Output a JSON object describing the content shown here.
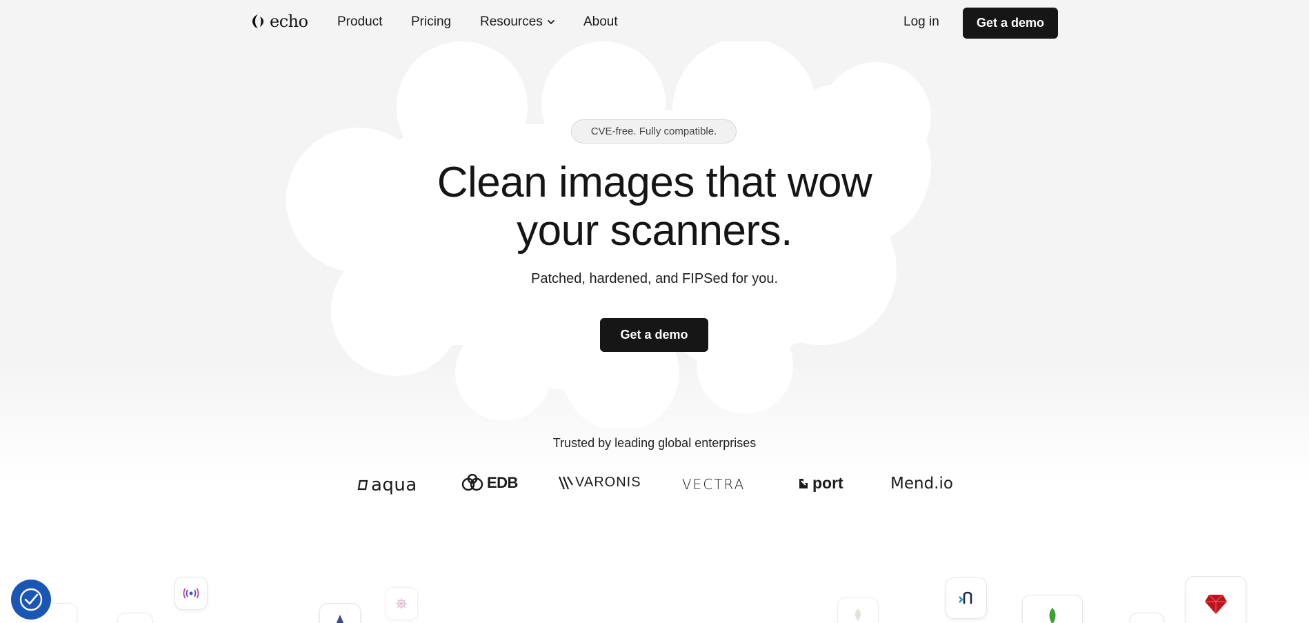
{
  "nav": {
    "logo_text": "echo",
    "links": {
      "product": "Product",
      "pricing": "Pricing",
      "resources": "Resources",
      "about": "About"
    },
    "login": "Log in",
    "cta": "Get a demo"
  },
  "hero": {
    "badge": "CVE-free. Fully compatible.",
    "title_line1": "Clean images that wow",
    "title_line2": "your scanners.",
    "subtitle": "Patched, hardened, and FIPSed for you.",
    "cta": "Get a demo"
  },
  "trust": {
    "heading": "Trusted by leading global enterprises",
    "logos": [
      "aqua",
      "EDB",
      "VARONIS",
      "VECTRA",
      "port",
      "Mend.io"
    ]
  },
  "icons": [
    "accessibility-icon",
    "radio-signal-icon",
    "rocky-linux-icon",
    "helm-icon",
    "nginx-icon",
    "mongodb-leaf-icon",
    "ruby-icon"
  ],
  "colors": {
    "primary_dark": "#161616",
    "accessibility": "#1a56b3",
    "ruby": "#c0121d",
    "mongo": "#3fa037"
  }
}
